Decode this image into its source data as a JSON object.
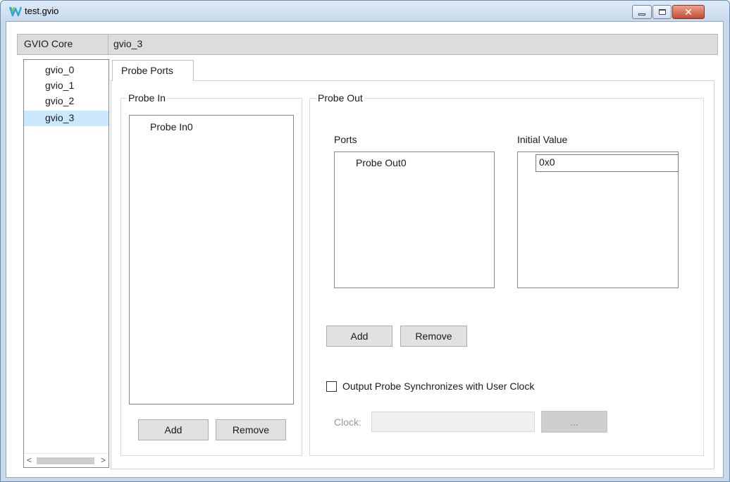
{
  "window": {
    "title": "test.gvio",
    "controls": {
      "minimize": "minimize-icon",
      "maximize": "maximize-icon",
      "close": "✕"
    }
  },
  "header": {
    "label": "GVIO Core",
    "value": "gvio_3"
  },
  "core_list": {
    "items": [
      "gvio_0",
      "gvio_1",
      "gvio_2",
      "gvio_3"
    ],
    "selected_index": 3,
    "scroll_left": "<",
    "scroll_right": ">"
  },
  "tabs": [
    {
      "label": "Probe Ports",
      "active": true
    }
  ],
  "probe_in": {
    "title": "Probe In",
    "items": [
      "Probe In0"
    ],
    "add_label": "Add",
    "remove_label": "Remove"
  },
  "probe_out": {
    "title": "Probe Out",
    "ports_header": "Ports",
    "initial_value_header": "Initial Value",
    "ports": [
      "Probe Out0"
    ],
    "initial_values": [
      "0x0"
    ],
    "add_label": "Add",
    "remove_label": "Remove",
    "sync_checkbox_label": "Output Probe Synchronizes with User Clock",
    "sync_checked": false,
    "clock_label": "Clock:",
    "clock_value": "",
    "browse_label": "..."
  },
  "colors": {
    "titlebar": "#c7d9ee",
    "header_bg": "#dcdcdc",
    "selection": "#cce8ff",
    "button_bg": "#e1e1e1",
    "close_button": "#c44c34"
  }
}
